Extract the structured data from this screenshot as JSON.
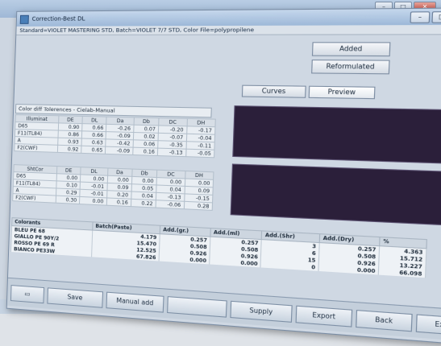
{
  "window": {
    "title": "Correction-Best DL",
    "standard_line": "Standard=VIOLET MASTERING STD, Batch=VIOLET 7/7 STD, Color File=polypropilene"
  },
  "buttons": {
    "added": "Added",
    "reformulated": "Reformulated",
    "curves": "Curves",
    "preview": "Preview"
  },
  "tolerance_label": "Color diff Tolerences - Cielab-Manual",
  "grid1": {
    "headers": [
      "Illuminat",
      "DE",
      "DL",
      "Da",
      "Db",
      "DC",
      "DH"
    ],
    "rows": [
      [
        "D65",
        "0.90",
        "0.66",
        "-0.26",
        "0.07",
        "-0.20",
        "-0.17"
      ],
      [
        "F11(TL84)",
        "0.86",
        "0.66",
        "-0.09",
        "0.02",
        "-0.07",
        "-0.04"
      ],
      [
        "A",
        "0.93",
        "0.63",
        "-0.42",
        "0.06",
        "-0.35",
        "-0.11"
      ],
      [
        "F2(CWF)",
        "0.92",
        "0.65",
        "-0.09",
        "0.16",
        "-0.13",
        "-0.05"
      ]
    ]
  },
  "grid2": {
    "headers": [
      "ShtCor",
      "DE",
      "DL",
      "Da",
      "Db",
      "DC",
      "DH"
    ],
    "rows": [
      [
        "D65",
        "0.00",
        "0.00",
        "0.00",
        "0.00",
        "0.00",
        "0.00"
      ],
      [
        "F11(TL84)",
        "0.10",
        "-0.01",
        "0.09",
        "0.05",
        "0.04",
        "0.09"
      ],
      [
        "A",
        "0.29",
        "-0.01",
        "0.20",
        "0.04",
        "-0.13",
        "-0.15"
      ],
      [
        "F2(CWF)",
        "0.30",
        "0.00",
        "0.16",
        "0.22",
        "-0.06",
        "0.28"
      ]
    ]
  },
  "colorants": {
    "headers": [
      "Colorants",
      "Batch(Paste)",
      "Add.(gr.)",
      "Add.(ml)",
      "Add.(Shr)",
      "Add.(Dry)",
      "%"
    ],
    "rows": [
      [
        "BLEU PE 68",
        "4.179",
        "0.257",
        "0.257",
        "3",
        "0.257",
        "4.363"
      ],
      [
        "GIALLO PE 90Y/2",
        "15.470",
        "0.508",
        "0.508",
        "6",
        "0.508",
        "15.712"
      ],
      [
        "ROSSO PE 69 R",
        "12.525",
        "0.926",
        "0.926",
        "15",
        "0.926",
        "13.227"
      ],
      [
        "BIANCO PE33W",
        "67.826",
        "0.000",
        "0.000",
        "0",
        "0.000",
        "66.098"
      ]
    ]
  },
  "footer": [
    "Save",
    "Manual add",
    "",
    "Supply",
    "Export",
    "Back",
    "Exit"
  ]
}
